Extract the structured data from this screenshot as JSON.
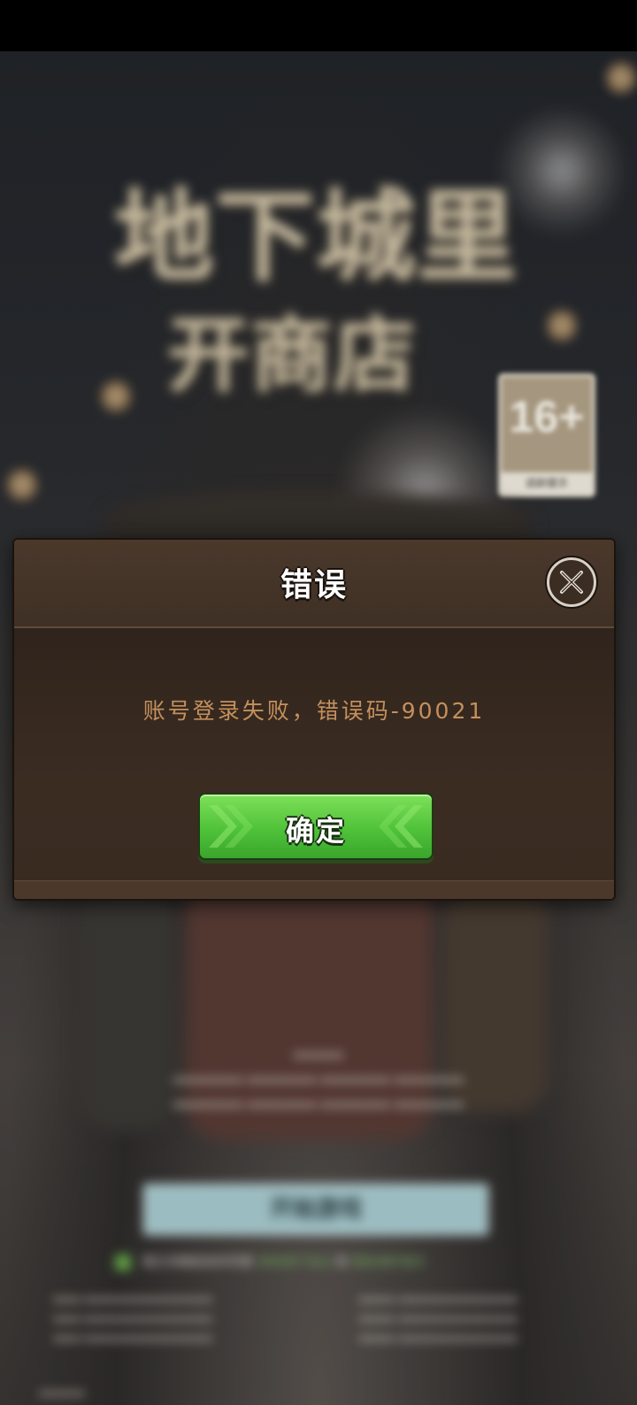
{
  "background": {
    "game_title_line1": "地下城里",
    "game_title_line2": "开商店",
    "age_rating": "16+",
    "age_rating_caption": "适龄提示",
    "start_button_label": "开始游戏",
    "agree_text": "我已详细阅读并同意",
    "agree_link_1": "游戏用户协议",
    "agree_and": "和",
    "agree_link_2": "隐私保护指引"
  },
  "dialog": {
    "title": "错误",
    "message": "账号登录失败，错误码-90021",
    "confirm_label": "确定",
    "close_icon": "close-icon"
  },
  "colors": {
    "dialog_bg": "#3a2c22",
    "message_text": "#c4905c",
    "confirm_green": "#4fc23a"
  }
}
